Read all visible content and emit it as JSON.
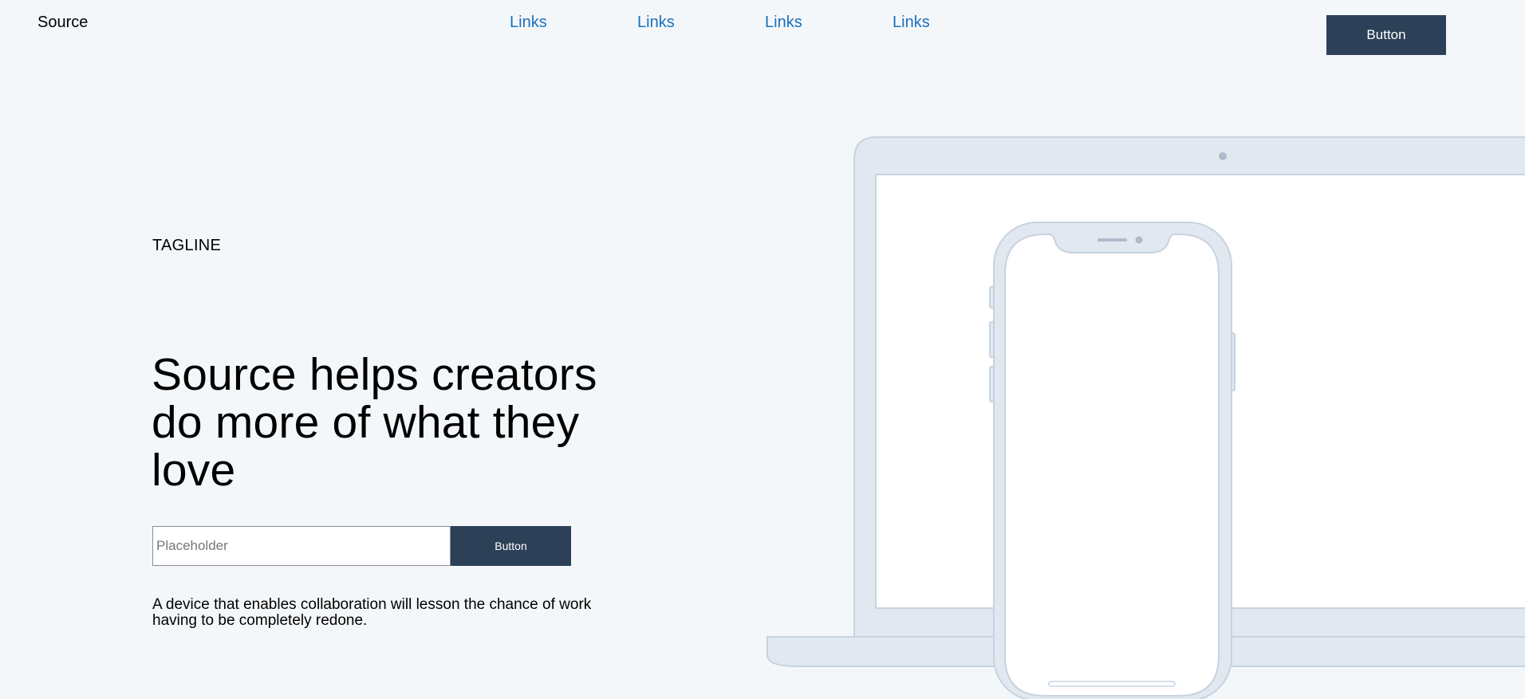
{
  "header": {
    "brand": "Source",
    "nav_links": [
      "Links",
      "Links",
      "Links",
      "Links"
    ],
    "button_label": "Button"
  },
  "hero": {
    "tagline": "TAGLINE",
    "title": "Source helps creators do more of what they love",
    "signup": {
      "input_placeholder": "Placeholder",
      "button_label": "Button"
    },
    "description": "A device that enables collaboration will lesson the chance of work having to be completely redone."
  },
  "colors": {
    "background": "#f4f7fa",
    "button": "#2c4158",
    "link": "#1a6fc0",
    "device_fill": "#e2e8f0",
    "device_stroke": "#c7d3df"
  },
  "icons": [
    "laptop-illustration",
    "phone-illustration"
  ]
}
